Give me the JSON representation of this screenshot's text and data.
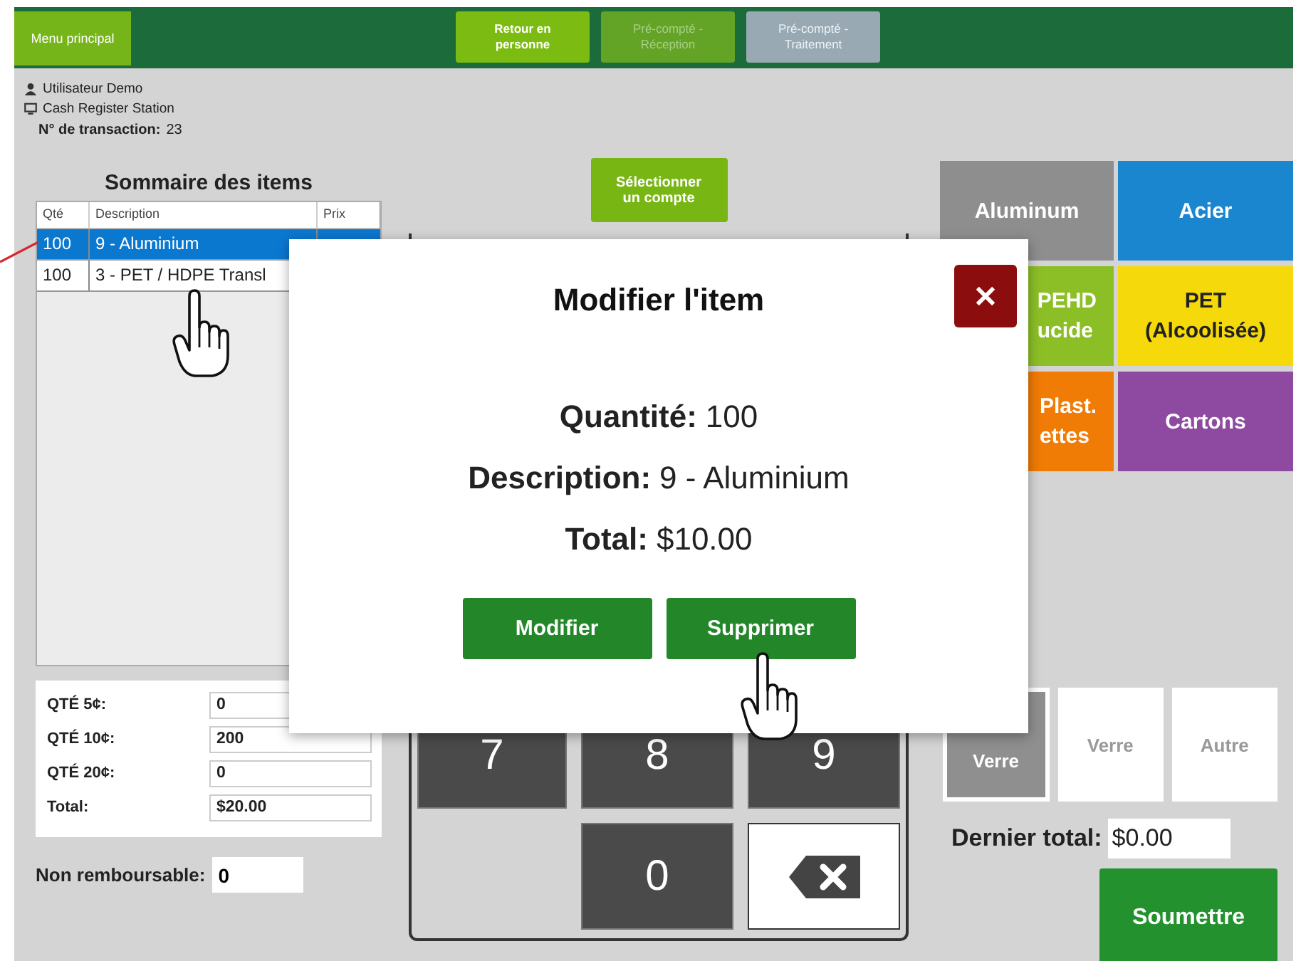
{
  "top_bar": {
    "menu_button": "Menu principal",
    "nav_buttons": [
      {
        "label": "Retour en personne",
        "selected": true,
        "disabled": false
      },
      {
        "label": "Pré-compté - Réception",
        "selected": false,
        "disabled": false
      },
      {
        "label": "Pré-compté - Traitement",
        "selected": false,
        "disabled": true
      }
    ]
  },
  "session": {
    "user": "Utilisateur Demo",
    "station": "Cash Register Station",
    "transaction_label": "N° de transaction:",
    "transaction_number": "23"
  },
  "items": {
    "title": "Sommaire des items",
    "columns": [
      "Qté",
      "Description",
      "Prix"
    ],
    "rows": [
      {
        "qty": "100",
        "description": "9 - Aluminium",
        "selected": true
      },
      {
        "qty": "100",
        "description": "3 - PET / HDPE Transl",
        "selected": false
      }
    ]
  },
  "counts": [
    {
      "label": "QTÉ 5¢:",
      "value": "0"
    },
    {
      "label": "QTÉ 10¢:",
      "value": "200"
    },
    {
      "label": "QTÉ 20¢:",
      "value": "0"
    },
    {
      "label": "Total:",
      "value": "$20.00"
    }
  ],
  "non_refundable": {
    "label": "Non remboursable:",
    "value": "0"
  },
  "select_account_button": "Sélectionner un compte",
  "keypad": [
    {
      "kind": "key",
      "label": "7"
    },
    {
      "kind": "key",
      "label": "8"
    },
    {
      "kind": "key",
      "label": "9"
    },
    {
      "kind": "blank"
    },
    {
      "kind": "key",
      "label": "0"
    },
    {
      "kind": "backspace"
    }
  ],
  "categories": [
    {
      "label": "Aluminum",
      "color": "#8e8e8e"
    },
    {
      "label": "Acier",
      "color": "#1a86d0"
    },
    {
      "label": "PEHD\nucide",
      "color": "#8cbf26"
    },
    {
      "label": "PET\n(Alcoolisée)",
      "color": "#f5d90a"
    },
    {
      "label": "Plast.\nettes",
      "color": "#f07b05"
    },
    {
      "label": "Cartons",
      "color": "#8e4aa0"
    }
  ],
  "small_tiles": [
    {
      "label": "Verre",
      "selected": true
    },
    {
      "label": "Verre",
      "selected": false
    },
    {
      "label": "Autre",
      "selected": false
    }
  ],
  "last_total": {
    "label": "Dernier total:",
    "value": "$0.00"
  },
  "submit_button": "Soumettre",
  "modal": {
    "title": "Modifier l'item",
    "fields": [
      {
        "label": "Quantité:",
        "value": "100"
      },
      {
        "label": "Description:",
        "value": "9 - Aluminium"
      },
      {
        "label": "Total:",
        "value": "$10.00"
      }
    ],
    "buttons": [
      "Modifier",
      "Supprimer"
    ]
  }
}
